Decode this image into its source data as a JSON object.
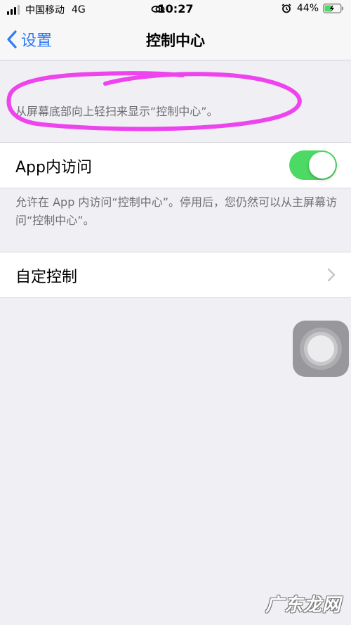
{
  "status_bar": {
    "carrier": "中国移动",
    "network": "4G",
    "time": "10:27",
    "battery_percent": "44%",
    "battery_level": 0.44,
    "battery_color": "#4cd964"
  },
  "nav": {
    "back_label": "设置",
    "title": "控制中心",
    "accent_color": "#2f7bf6"
  },
  "section_header": {
    "text": "从屏幕底部向上轻扫来显示“控制中心”。",
    "highlight_color": "#ee44ee"
  },
  "app_access": {
    "label": "App内访问",
    "toggle_on": true,
    "toggle_color": "#4cd964",
    "description": "允许在 App 内访问“控制中心”。停用后，您仍然可以从主屏幕访问“控制中心”。"
  },
  "customize": {
    "label": "自定控制"
  },
  "icons": {
    "signal": "signal-bars-icon",
    "link": "link-icon",
    "alarm": "alarm-clock-icon",
    "battery": "battery-icon",
    "back": "chevron-left-icon",
    "disclosure": "chevron-right-icon",
    "assistive_touch": "assistive-touch-icon"
  },
  "watermark": {
    "text": "广东龙网"
  }
}
